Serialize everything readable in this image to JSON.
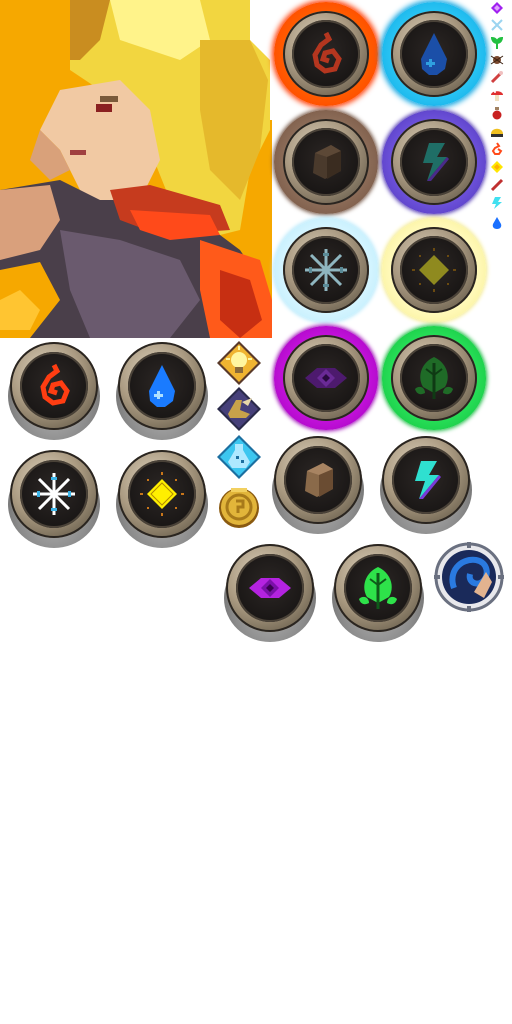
{
  "sheet": {
    "description_free": true
  },
  "colors": {
    "background": "#ffffff",
    "portrait_bg": "#f6a800",
    "hair": "#f2d640",
    "fire": "#ff4400",
    "water": "#1fb7ee",
    "earth": "#7a5a44",
    "lightning": "#5a3fc4",
    "ice": "#c8f2ff",
    "light": "#fff7a6",
    "shadow": "#b000c8",
    "nature": "#1ecf45"
  },
  "orbs_glow": [
    {
      "element": "fire",
      "icon": "fire-swirl-icon",
      "ring": "#ff5a00",
      "halo": "#ff3a00",
      "symbol": "#b5361f"
    },
    {
      "element": "water",
      "icon": "water-drop-icon",
      "ring": "#27c2f2",
      "halo": "#0aa4e2",
      "symbol": "#1b4fa8"
    },
    {
      "element": "earth",
      "icon": "earth-rock-icon",
      "ring": "#8a6a56",
      "halo": "#6d4d3b",
      "symbol": "#4a3a2c"
    },
    {
      "element": "lightning",
      "icon": "lightning-bolt-icon",
      "ring": "#6a4fd8",
      "halo": "#4a30b0",
      "symbol": "#1f6e66"
    },
    {
      "element": "ice",
      "icon": "snowflake-icon",
      "ring": "#d3f4ff",
      "halo": "#b3e8fb",
      "symbol": "#8fb6c0"
    },
    {
      "element": "light",
      "icon": "light-diamond-icon",
      "ring": "#fff9b8",
      "halo": "#f4ea88",
      "symbol": "#8f8a1f"
    },
    {
      "element": "shadow",
      "icon": "shadow-eye-icon",
      "ring": "#c010d8",
      "halo": "#9a00b4",
      "symbol": "#4d1a6e"
    },
    {
      "element": "nature",
      "icon": "nature-leaf-icon",
      "ring": "#25dc55",
      "halo": "#10b83a",
      "symbol": "#1f6b27"
    }
  ],
  "orbs_plain": [
    {
      "element": "fire",
      "icon": "fire-swirl-icon",
      "symbol": "#ff3d12"
    },
    {
      "element": "water",
      "icon": "water-drop-icon",
      "symbol": "#1a7bff"
    },
    {
      "element": "ice",
      "icon": "snowflake-icon",
      "symbol": "#ffffff"
    },
    {
      "element": "light",
      "icon": "light-diamond-icon",
      "symbol": "#ffef00"
    },
    {
      "element": "earth",
      "icon": "earth-rock-icon",
      "symbol": "#8a6a4a"
    },
    {
      "element": "lightning",
      "icon": "lightning-bolt-icon",
      "symbol": "#2fe0d0"
    },
    {
      "element": "shadow",
      "icon": "shadow-eye-icon",
      "symbol": "#b423e0"
    },
    {
      "element": "nature",
      "icon": "nature-leaf-icon",
      "symbol": "#2ee24a"
    }
  ],
  "badges": [
    {
      "icon": "lightbulb-icon",
      "fill": "#f0b431"
    },
    {
      "icon": "winged-boot-icon",
      "fill": "#c8a24a"
    },
    {
      "icon": "potion-flask-icon",
      "fill": "#3cc6f0"
    },
    {
      "icon": "gold-coin-icon",
      "fill": "#e2b53a"
    }
  ],
  "swirl_emblem": {
    "icon": "water-swirl-emblem-icon",
    "primary": "#2a4fb8",
    "accent": "#e2b38f"
  },
  "tiny_icons": [
    {
      "icon": "purple-gem-icon",
      "color": "#a020f0"
    },
    {
      "icon": "crossed-swords-icon",
      "color": "#9bd4f0"
    },
    {
      "icon": "green-sprout-icon",
      "color": "#22c040"
    },
    {
      "icon": "brown-spider-icon",
      "color": "#7a4a30"
    },
    {
      "icon": "red-wand-icon",
      "color": "#d04040"
    },
    {
      "icon": "mushroom-icon",
      "color": "#e03030"
    },
    {
      "icon": "red-potion-icon",
      "color": "#c82020"
    },
    {
      "icon": "yellow-helmet-icon",
      "color": "#f0c020"
    },
    {
      "icon": "fire-swirl-icon",
      "color": "#ff4a1a"
    },
    {
      "icon": "yellow-diamond-icon",
      "color": "#ffe600"
    },
    {
      "icon": "red-staff-icon",
      "color": "#c03030"
    },
    {
      "icon": "lightning-bolt-icon",
      "color": "#40e0f0"
    },
    {
      "icon": "water-drop-icon",
      "color": "#1a70ff"
    }
  ]
}
